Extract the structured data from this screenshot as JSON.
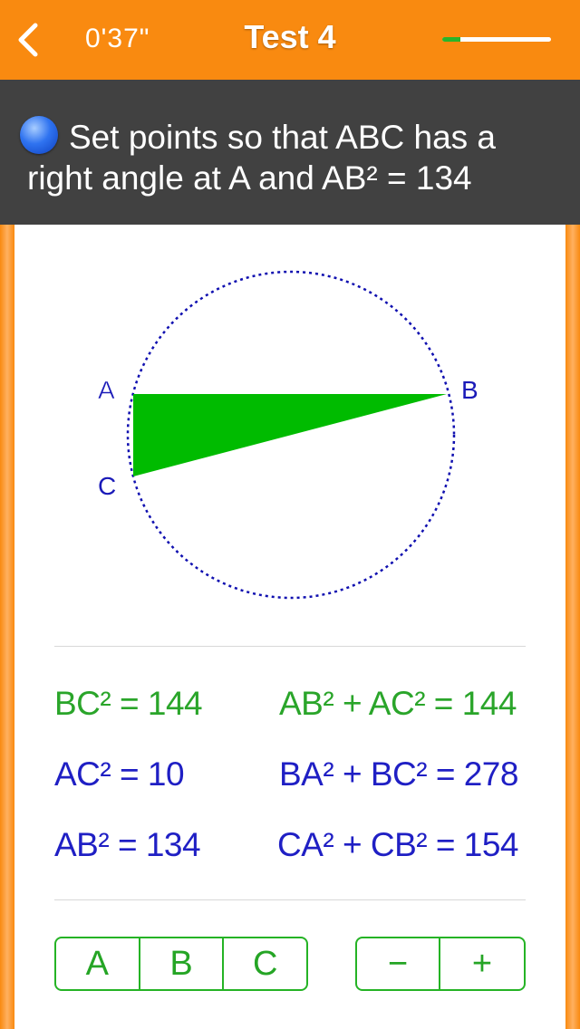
{
  "header": {
    "timer": "0'37\"",
    "title": "Test 4",
    "progress_fraction": 0.17,
    "colors": {
      "bar": "#f98a10",
      "progress_fill": "#29b42a"
    },
    "back_icon": "chevron-left-icon"
  },
  "instruction": {
    "bullet_icon": "blue-ball-icon",
    "line1": "Set points so that ABC has a",
    "line2": "right angle at A and AB² = 134"
  },
  "figure": {
    "labels": {
      "a": "A",
      "b": "B",
      "c": "C"
    },
    "colors": {
      "triangle": "#00bb00",
      "circle": "#1010b0",
      "label": "#1a1ab8"
    }
  },
  "results": {
    "left": [
      {
        "text": "BC² = 144",
        "color": "green"
      },
      {
        "text": "AC² = 10",
        "color": "blue"
      },
      {
        "text": "AB² = 134",
        "color": "blue"
      }
    ],
    "right": [
      {
        "text": "AB² + AC² = 144",
        "color": "green"
      },
      {
        "text": "BA² + BC² = 278",
        "color": "blue"
      },
      {
        "text": "CA² + CB² = 154",
        "color": "blue"
      }
    ]
  },
  "controls": {
    "points": [
      "A",
      "B",
      "C"
    ],
    "minus": "−",
    "plus": "+"
  }
}
